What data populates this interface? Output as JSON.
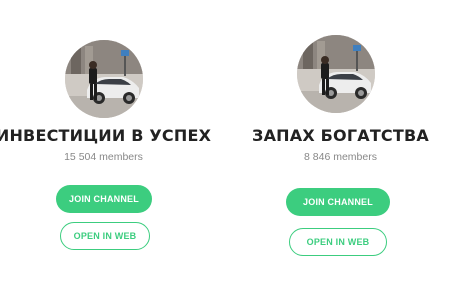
{
  "channels": [
    {
      "name": "ИНВЕСТИЦИИ В УСПЕХ",
      "members": "15 504 members",
      "join_label": "JOIN CHANNEL",
      "web_label": "OPEN IN WEB"
    },
    {
      "name": "ЗАПАХ БОГАТСТВА",
      "members": "8 846 members",
      "join_label": "JOIN CHANNEL",
      "web_label": "OPEN IN WEB"
    }
  ],
  "colors": {
    "accent": "#3ccd7f",
    "title": "#222222",
    "subtext": "#888888"
  }
}
